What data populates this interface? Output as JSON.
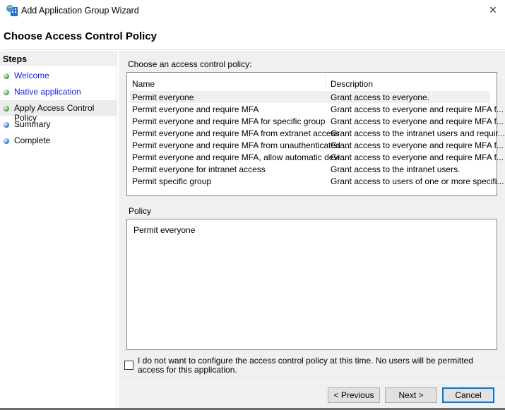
{
  "window": {
    "title": "Add Application Group Wizard",
    "close_icon": "×"
  },
  "header": {
    "title": "Choose Access Control Policy"
  },
  "steps": {
    "heading": "Steps",
    "items": [
      {
        "label": "Welcome",
        "status": "done",
        "color": "#3cb043",
        "link": true
      },
      {
        "label": "Native application",
        "status": "done",
        "color": "#3cb043",
        "link": true
      },
      {
        "label": "Apply Access Control Policy",
        "status": "current",
        "color": "#3cb043",
        "link": false
      },
      {
        "label": "Summary",
        "status": "pending",
        "color": "#2a7fe0",
        "link": false
      },
      {
        "label": "Complete",
        "status": "pending",
        "color": "#2a7fe0",
        "link": false
      }
    ]
  },
  "main": {
    "choose_label": "Choose an access control policy:",
    "columns": [
      "Name",
      "Description"
    ],
    "rows": [
      {
        "name": "Permit everyone",
        "description": "Grant access to everyone.",
        "selected": true
      },
      {
        "name": "Permit everyone and require MFA",
        "description": "Grant access to everyone and require MFA f..."
      },
      {
        "name": "Permit everyone and require MFA for specific group",
        "description": "Grant access to everyone and require MFA f..."
      },
      {
        "name": "Permit everyone and require MFA from extranet access",
        "description": "Grant access to the intranet users and requir..."
      },
      {
        "name": "Permit everyone and require MFA from unauthenticated ...",
        "description": "Grant access to everyone and require MFA f..."
      },
      {
        "name": "Permit everyone and require MFA, allow automatic devi...",
        "description": "Grant access to everyone and require MFA f..."
      },
      {
        "name": "Permit everyone for intranet access",
        "description": "Grant access to the intranet users."
      },
      {
        "name": "Permit specific group",
        "description": "Grant access to users of one or more specifi..."
      }
    ],
    "policy_label": "Policy",
    "policy_text": "Permit everyone",
    "skip_checkbox": {
      "label": "I do not want to configure the access control policy at this time.  No users will be permitted access for this application.",
      "checked": false
    }
  },
  "buttons": {
    "previous": "< Previous",
    "next": "Next >",
    "cancel": "Cancel"
  }
}
